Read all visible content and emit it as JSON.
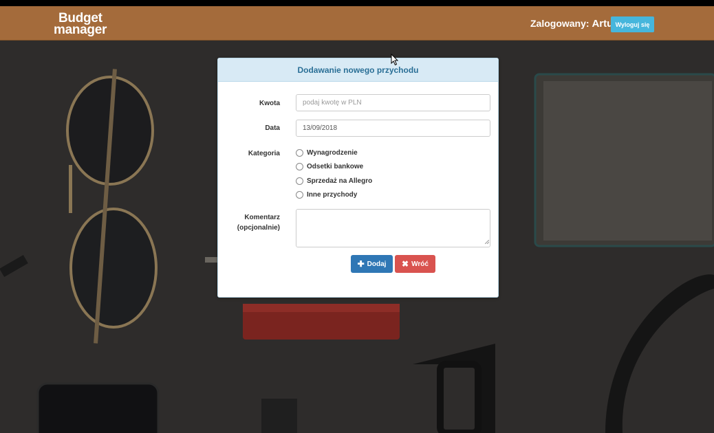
{
  "navbar": {
    "brand_line1": "Budget",
    "brand_line2": "manager",
    "logged_label": "Zalogowany:",
    "username": "Artur",
    "logout_label": "Wyloguj się",
    "bg_color": "#a46b3b",
    "logout_color": "#46b6dc"
  },
  "form": {
    "title": "Dodawanie nowego przychodu",
    "amount": {
      "label": "Kwota",
      "value": "",
      "placeholder": "podaj kwotę w PLN"
    },
    "date": {
      "label": "Data",
      "value": "13/09/2018"
    },
    "category": {
      "label": "Kategoria",
      "options": [
        "Wynagrodzenie",
        "Odsetki bankowe",
        "Sprzedaż na Allegro",
        "Inne przychody"
      ],
      "selected": null
    },
    "comment": {
      "label_line1": "Komentarz",
      "label_line2": "(opcjonalnie)",
      "value": ""
    },
    "add_label": "Dodaj",
    "back_label": "Wróć",
    "add_icon": "plus-icon",
    "back_icon": "close-icon",
    "add_color": "#2f77b5",
    "back_color": "#d9534f"
  }
}
